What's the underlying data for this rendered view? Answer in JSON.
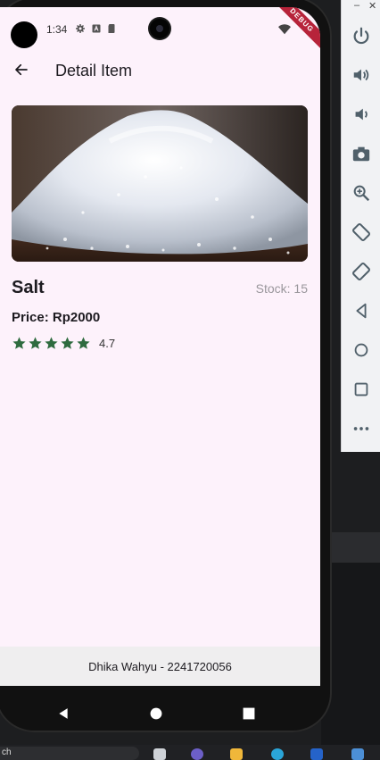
{
  "status": {
    "time": "1:34"
  },
  "debug_banner": "DEBUG",
  "appbar": {
    "title": "Detail Item"
  },
  "item": {
    "name": "Salt",
    "stock_text": "Stock: 15",
    "price_text": "Price: Rp2000",
    "rating": 4.7,
    "rating_text": "4.7",
    "stars": 5
  },
  "footer": {
    "text": "Dhika Wahyu - 2241720056"
  },
  "emulator_toolbar": {
    "buttons": [
      "power-icon",
      "volume-up-icon",
      "volume-down-icon",
      "camera-icon",
      "zoom-icon",
      "rotate-left-icon",
      "rotate-right-icon",
      "back-icon",
      "home-icon",
      "overview-icon",
      "more-icon"
    ]
  },
  "taskbar": {
    "search_fragment": "ch"
  },
  "colors": {
    "screen_bg": "#fdf2fb",
    "star": "#2e6b3f",
    "debug": "#b7233a",
    "footer_bg": "#efeeef"
  }
}
